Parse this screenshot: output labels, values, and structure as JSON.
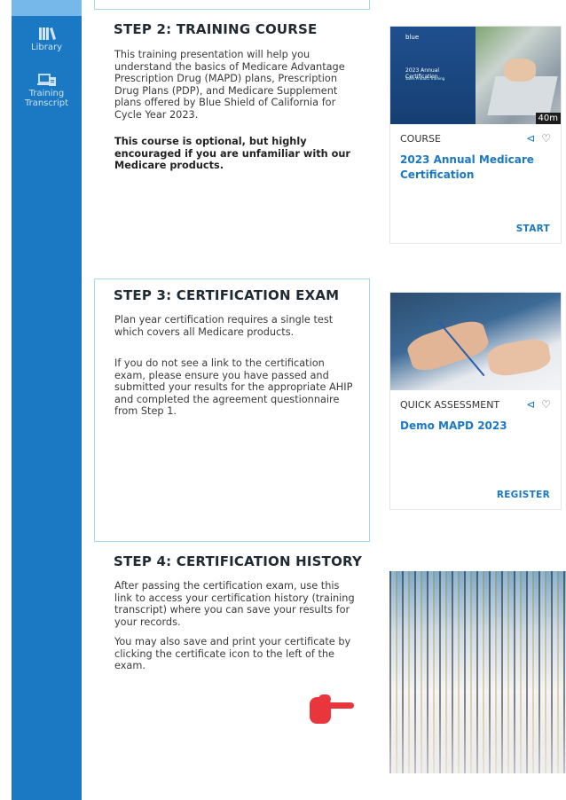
{
  "sidebar": {
    "items": [
      {
        "label": "Library",
        "icon": "library-icon"
      },
      {
        "label": "Training Transcript",
        "icon": "transcript-icon"
      }
    ]
  },
  "steps": [
    {
      "title": "STEP 2: TRAINING COURSE",
      "paragraphs": [
        "This training presentation will help you understand the basics of Medicare Advantage Prescription Drug (MAPD) plans, Prescription Drug Plans (PDP), and Medicare Supplement plans offered by Blue Shield of California for Cycle Year 2023.",
        "This course is optional, but highly encouraged if you are unfamiliar with our Medicare products."
      ],
      "tile": {
        "type": "COURSE",
        "name": "2023 Annual Medicare Certification",
        "cta": "START",
        "badge": "40m",
        "thumb_title": "2023 Annual Certification",
        "thumb_sub": "Sales Product Training",
        "thumb_logo": "blue"
      }
    },
    {
      "title": "STEP 3: CERTIFICATION EXAM",
      "paragraphs": [
        "Plan year certification requires a single test which covers all Medicare products.",
        "If you do not see a link to the certification exam, please ensure you have passed and submitted your results for the appropriate AHIP and completed the agreement questionnaire from Step 1."
      ],
      "tile": {
        "type": "QUICK ASSESSMENT",
        "name": "Demo MAPD 2023",
        "cta": "REGISTER"
      }
    },
    {
      "title": "STEP 4: CERTIFICATION HISTORY",
      "paragraphs": [
        "After passing the certification exam, use this link to access your certification history (training transcript) where you can save your results for your records.",
        "You may also save and print your certificate by clicking the certificate icon to the left of the exam."
      ]
    }
  ],
  "colors": {
    "accent": "#1b78c2",
    "sidebar": "#1b78c2",
    "border": "#a9d6ea",
    "pointer": "#e8363c"
  }
}
